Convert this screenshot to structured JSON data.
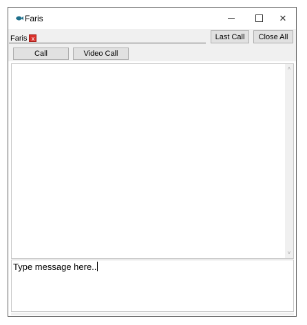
{
  "window": {
    "title": "Faris",
    "controls": {
      "minimize": "—",
      "maximize": "",
      "close": "✕"
    }
  },
  "tabs": [
    {
      "label": "Faris",
      "close": "x"
    }
  ],
  "header_buttons": {
    "last_call": "Last Call",
    "close_all": "Close All"
  },
  "toolbar": {
    "call": "Call",
    "video_call": "Video Call"
  },
  "chat": {
    "scroll_up": "˄",
    "scroll_down": "˅"
  },
  "message_input": {
    "value": "Type message here.."
  },
  "colors": {
    "tab_close_bg": "#d9302a",
    "app_icon": "#1f6f8b",
    "button_bg": "#e1e1e1",
    "toolbar_bg": "#f0f0f0"
  },
  "icons": {
    "app": "fish-icon",
    "tab_close": "close-icon"
  }
}
